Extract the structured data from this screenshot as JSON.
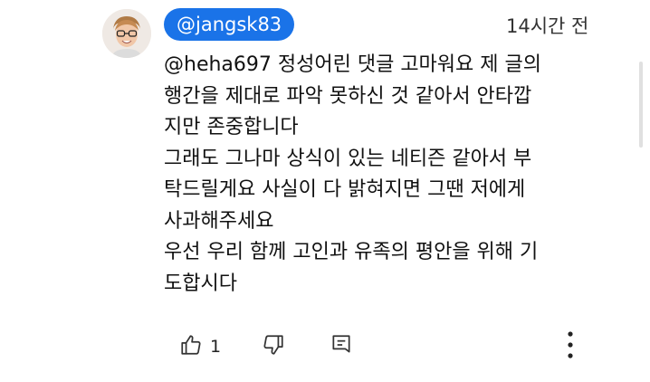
{
  "comment": {
    "author": "@jangsk83",
    "time": "14시간 전",
    "lines": [
      "@heha697 정성어린 댓글 고마워요 제 글의",
      "행간을 제대로 파악 못하신 것 같아서 안타깝",
      "지만 존중합니다",
      "그래도 그나마 상식이 있는 네티즌 같아서 부",
      "탁드릴게요 사실이 다 밝혀지면 그땐 저에게",
      "사과해주세요",
      "우선 우리 함께 고인과 유족의 평안을 위해 기",
      "도합시다"
    ]
  },
  "actions": {
    "like_icon": "thumb-up-icon",
    "like_count": "1",
    "dislike_icon": "thumb-down-icon",
    "reply_icon": "reply-icon",
    "more_icon": "more-vertical-icon"
  },
  "colors": {
    "author_chip": "#1a73e8",
    "text": "#111111",
    "icon": "#333333"
  }
}
